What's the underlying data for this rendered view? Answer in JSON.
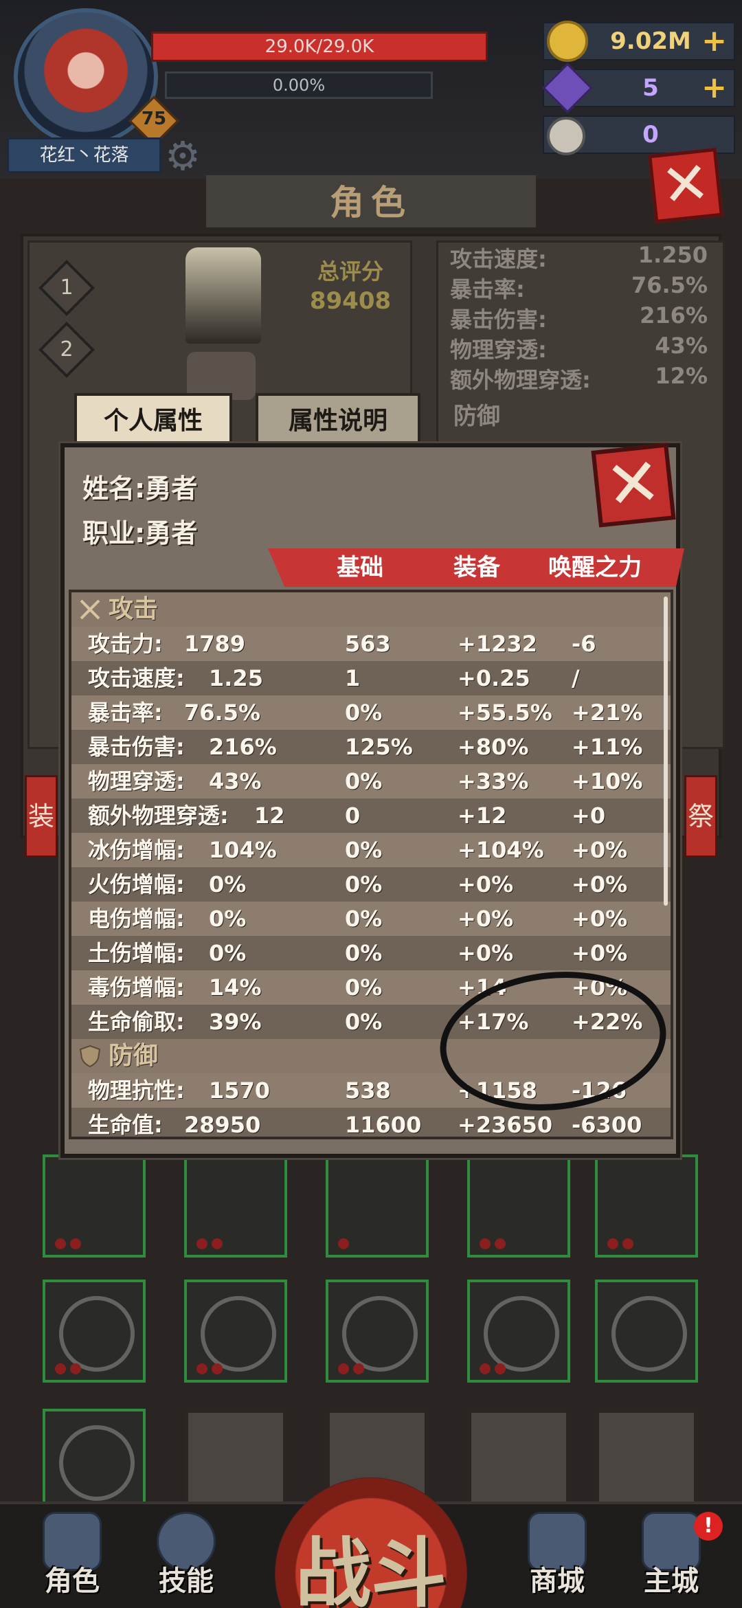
{
  "hud": {
    "player_name": "花红丶花落",
    "level": "75",
    "hp": "29.0K/29.0K",
    "xp": "0.00%",
    "gold": "9.02M",
    "gems": "5",
    "tokens": "0",
    "plus": "+"
  },
  "screen": {
    "title": "角色",
    "total_score_label": "总评分",
    "total_score": "89408",
    "loadouts": [
      "1",
      "2"
    ],
    "bg_stats": [
      {
        "label": "攻击速度:",
        "value": "1.250"
      },
      {
        "label": "暴击率:",
        "value": "76.5%"
      },
      {
        "label": "暴击伤害:",
        "value": "216%"
      },
      {
        "label": "物理穿透:",
        "value": "43%"
      },
      {
        "label": "额外物理穿透:",
        "value": "12%"
      }
    ],
    "bg_defense_label": "防御",
    "side_left": "装",
    "side_right": "祭"
  },
  "modal": {
    "tabs": [
      "个人属性",
      "属性说明"
    ],
    "name_label": "姓名:",
    "name_value": "勇者",
    "class_label": "职业:",
    "class_value": "勇者",
    "columns": [
      "基础",
      "装备",
      "唤醒之力"
    ],
    "close": "✕",
    "rows": [
      {
        "type": "section",
        "label": "攻击"
      },
      {
        "label": "攻击力:",
        "total": "1789",
        "base": "563",
        "equip": "+1232",
        "awaken": "-6"
      },
      {
        "label": "攻击速度:",
        "total": "1.25",
        "base": "1",
        "equip": "+0.25",
        "awaken": "/"
      },
      {
        "label": "暴击率:",
        "total": "76.5%",
        "base": "0%",
        "equip": "+55.5%",
        "awaken": "+21%"
      },
      {
        "label": "暴击伤害:",
        "total": "216%",
        "base": "125%",
        "equip": "+80%",
        "awaken": "+11%"
      },
      {
        "label": "物理穿透:",
        "total": "43%",
        "base": "0%",
        "equip": "+33%",
        "awaken": "+10%"
      },
      {
        "label": "额外物理穿透:",
        "total": "12",
        "base": "0",
        "equip": "+12",
        "awaken": "+0"
      },
      {
        "label": "冰伤增幅:",
        "total": "104%",
        "base": "0%",
        "equip": "+104%",
        "awaken": "+0%"
      },
      {
        "label": "火伤增幅:",
        "total": "0%",
        "base": "0%",
        "equip": "+0%",
        "awaken": "+0%"
      },
      {
        "label": "电伤增幅:",
        "total": "0%",
        "base": "0%",
        "equip": "+0%",
        "awaken": "+0%"
      },
      {
        "label": "土伤增幅:",
        "total": "0%",
        "base": "0%",
        "equip": "+0%",
        "awaken": "+0%"
      },
      {
        "label": "毒伤增幅:",
        "total": "14%",
        "base": "0%",
        "equip": "+14",
        "awaken": "+0%"
      },
      {
        "label": "生命偷取:",
        "total": "39%",
        "base": "0%",
        "equip": "+17%",
        "awaken": "+22%"
      },
      {
        "type": "section",
        "label": "防御"
      },
      {
        "label": "物理抗性:",
        "total": "1570",
        "base": "538",
        "equip": "+1158",
        "awaken": "-126"
      },
      {
        "label": "生命值:",
        "total": "28950",
        "base": "11600",
        "equip": "+23650",
        "awaken": "-6300"
      }
    ]
  },
  "nav": {
    "items": [
      "角色",
      "技能",
      "商城",
      "主城"
    ],
    "battle": "战斗",
    "alert": "!"
  },
  "colors": {
    "accent_red": "#c73535",
    "slot_green": "#2f8c3c",
    "gold": "#f0c040"
  }
}
